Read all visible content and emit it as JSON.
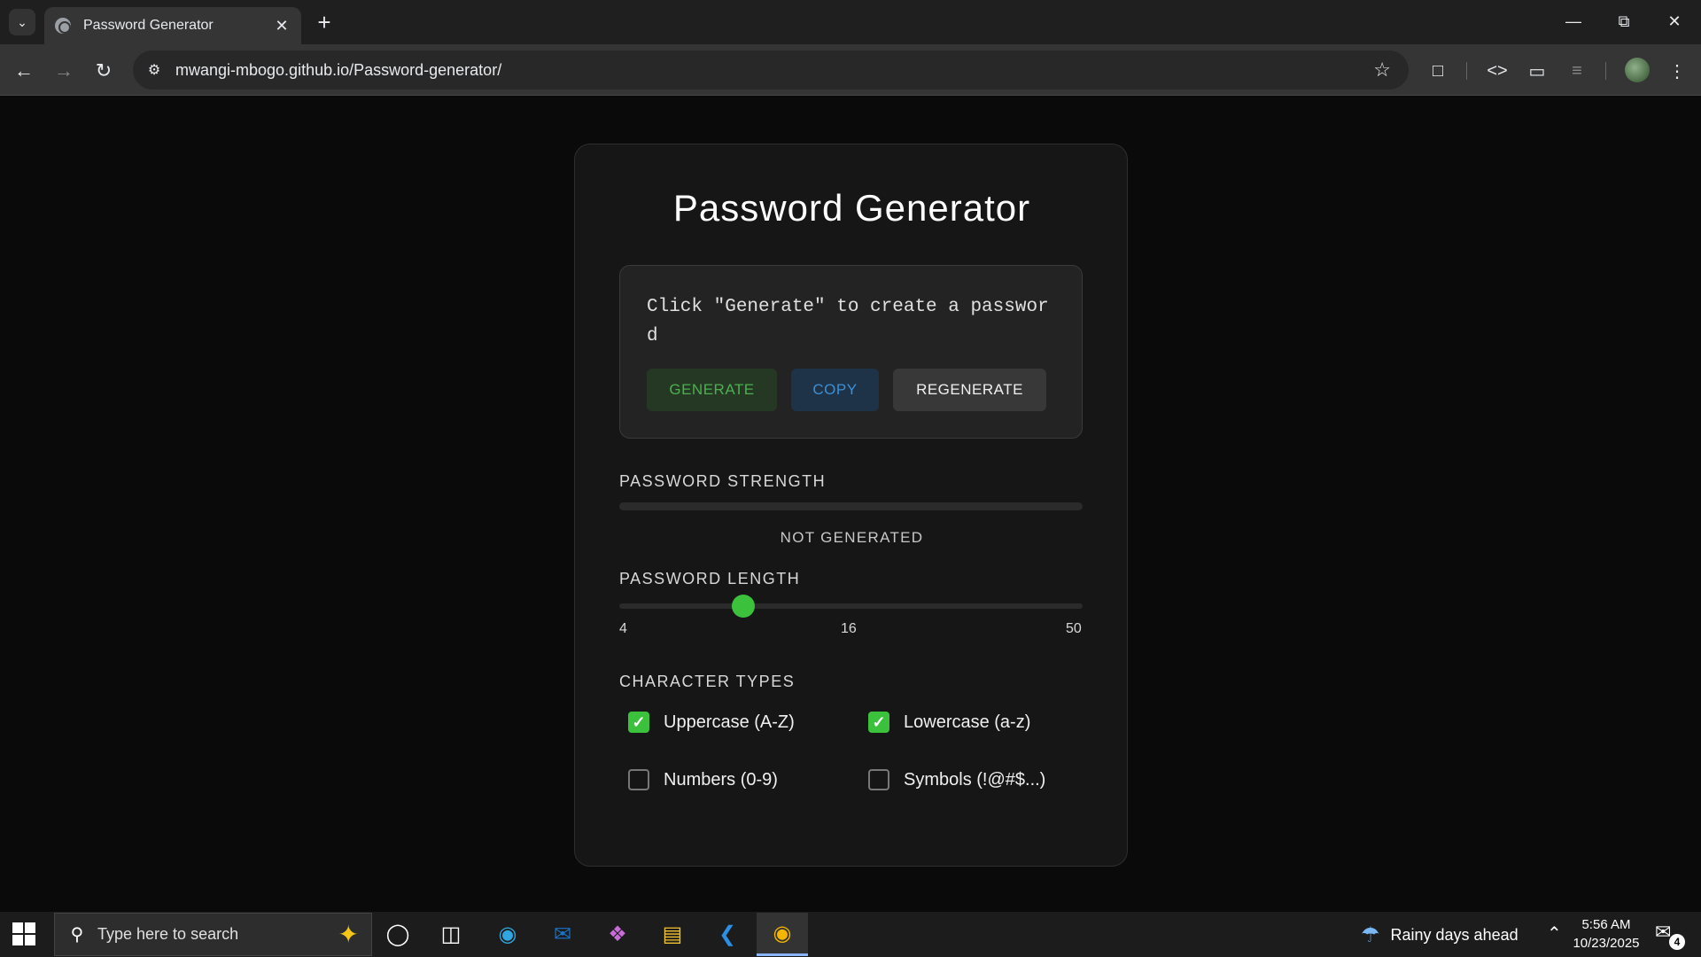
{
  "browser": {
    "tab_title": "Password Generator",
    "url": "mwangi-mbogo.github.io/Password-generator/"
  },
  "app": {
    "title": "Password Generator",
    "output_text": "Click \"Generate\" to create a password",
    "buttons": {
      "generate": "GENERATE",
      "copy": "COPY",
      "regenerate": "REGENERATE"
    },
    "strength": {
      "label": "PASSWORD STRENGTH",
      "status": "NOT GENERATED",
      "level_percent": 0
    },
    "length": {
      "label": "PASSWORD LENGTH",
      "min": "4",
      "value": "16",
      "max": "50"
    },
    "character_types": {
      "label": "CHARACTER TYPES",
      "uppercase": "Uppercase (A-Z)",
      "lowercase": "Lowercase (a-z)",
      "numbers": "Numbers (0-9)",
      "symbols": "Symbols (!@#$...)"
    }
  },
  "taskbar": {
    "search_placeholder": "Type here to search",
    "weather": "Rainy days ahead",
    "time": "5:56 AM",
    "date": "10/23/2025",
    "notification_count": "4"
  },
  "colors": {
    "accent_green": "#3cc13c",
    "copy_blue": "#3b8fd6"
  }
}
